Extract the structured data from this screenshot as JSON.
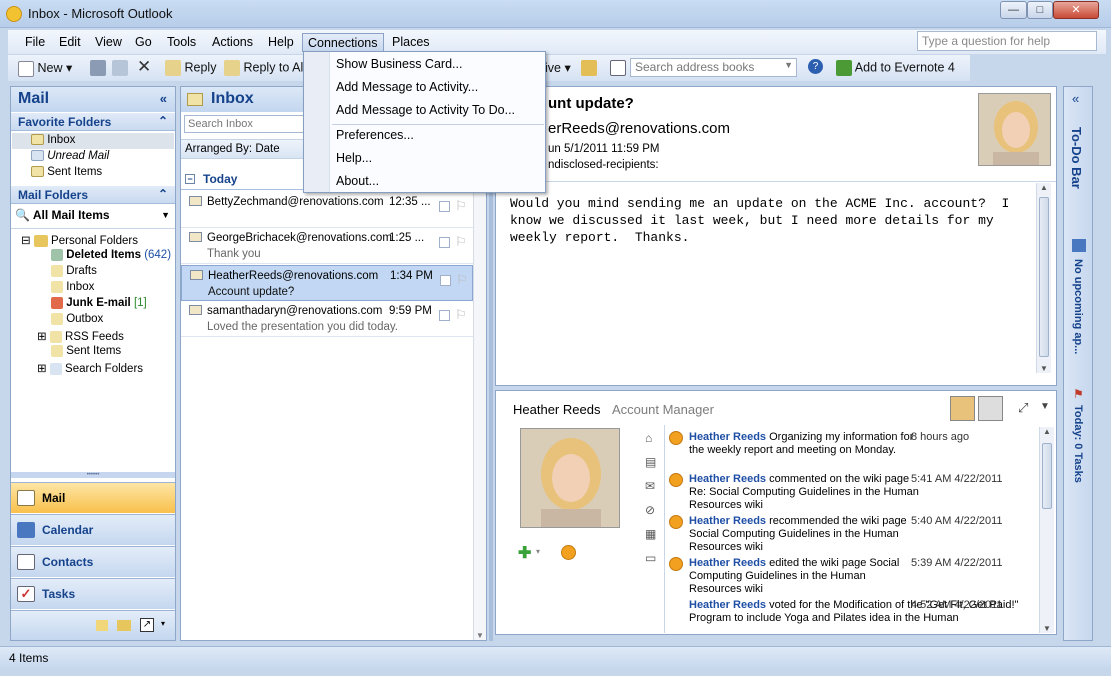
{
  "window": {
    "title": "Inbox - Microsoft Outlook",
    "min": "—",
    "max": "□",
    "close": "✕"
  },
  "menubar": {
    "items": [
      "File",
      "Edit",
      "View",
      "Go",
      "Tools",
      "Actions",
      "Help",
      "Connections",
      "Places"
    ],
    "help_placeholder": "Type a question for help"
  },
  "toolbar": {
    "new": "New",
    "reply": "Reply",
    "reply_all": "Reply to All",
    "ive_fragment": "ive",
    "search_address": "Search address books",
    "evernote": "Add to Evernote 4"
  },
  "connections_menu": {
    "items": [
      "Show Business Card...",
      "Add Message to Activity...",
      "Add Message to Activity To Do...",
      "Preferences...",
      "Help...",
      "About..."
    ]
  },
  "nav": {
    "title": "Mail",
    "favorites_header": "Favorite Folders",
    "favorites": [
      "Inbox",
      "Unread Mail",
      "Sent Items"
    ],
    "mail_folders_header": "Mail Folders",
    "all_mail": "All Mail Items",
    "personal": "Personal Folders",
    "folders": [
      {
        "name": "Deleted Items",
        "count": "(642)"
      },
      {
        "name": "Drafts",
        "count": ""
      },
      {
        "name": "Inbox",
        "count": ""
      },
      {
        "name": "Junk E-mail",
        "count": "[1]"
      },
      {
        "name": "Outbox",
        "count": ""
      },
      {
        "name": "RSS Feeds",
        "count": ""
      },
      {
        "name": "Sent Items",
        "count": ""
      },
      {
        "name": "Search Folders",
        "count": ""
      }
    ],
    "buttons": [
      "Mail",
      "Calendar",
      "Contacts",
      "Tasks"
    ]
  },
  "inbox": {
    "title": "Inbox",
    "search_placeholder": "Search Inbox",
    "arranged_by": "Arranged By: Date",
    "group": "Today",
    "messages": [
      {
        "from": "BettyZechmand@renovations.com",
        "time": "12:35 ...",
        "subject": ""
      },
      {
        "from": "GeorgeBrichacek@renovations.com",
        "time": "1:25 ...",
        "subject": "Thank you"
      },
      {
        "from": "HeatherReeds@renovations.com",
        "time": "1:34 PM",
        "subject": "Account update?"
      },
      {
        "from": "samanthadaryn@renovations.com",
        "time": "9:59 PM",
        "subject": "Loved the presentation you did today."
      }
    ]
  },
  "reading": {
    "subject": "unt update?",
    "from": "erReeds@renovations.com",
    "date": "un 5/1/2011 11:59 PM",
    "to": "ndisclosed-recipients:",
    "body": "Would you mind sending me an update on the ACME Inc. account?  I\nknow we discussed it last week, but I need more details for my\nweekly report.  Thanks."
  },
  "social": {
    "name": "Heather Reeds",
    "role": "Account Manager",
    "activities": [
      {
        "actor": "Heather Reeds",
        "text": " Organizing my information for the weekly report and meeting on Monday.",
        "time": "8 hours ago"
      },
      {
        "actor": "Heather Reeds",
        "text": " commented on the wiki page Re: Social Computing Guidelines in the Human Resources wiki",
        "time": "5:41 AM 4/22/2011"
      },
      {
        "actor": "Heather Reeds",
        "text": " recommended the wiki page Social Computing Guidelines in the Human Resources wiki",
        "time": "5:40 AM 4/22/2011"
      },
      {
        "actor": "Heather Reeds",
        "text": " edited the wiki page Social Computing Guidelines in the Human Resources wiki",
        "time": "5:39 AM 4/22/2011"
      },
      {
        "actor": "Heather Reeds",
        "text": " voted for the Modification of the \"Get Fit, Get Paid!\" Program to include Yoga and Pilates idea in the Human",
        "time": "4:52 AM 4/22/2011"
      }
    ]
  },
  "todo": {
    "title": "To-Do Bar",
    "appointments": "No upcoming ap...",
    "tasks": "Today: 0 Tasks"
  },
  "status": {
    "items": "4 Items"
  },
  "colors": {
    "accent": "#15428b",
    "active_nav": "#f9c04c",
    "link": "#1f4fa5"
  }
}
